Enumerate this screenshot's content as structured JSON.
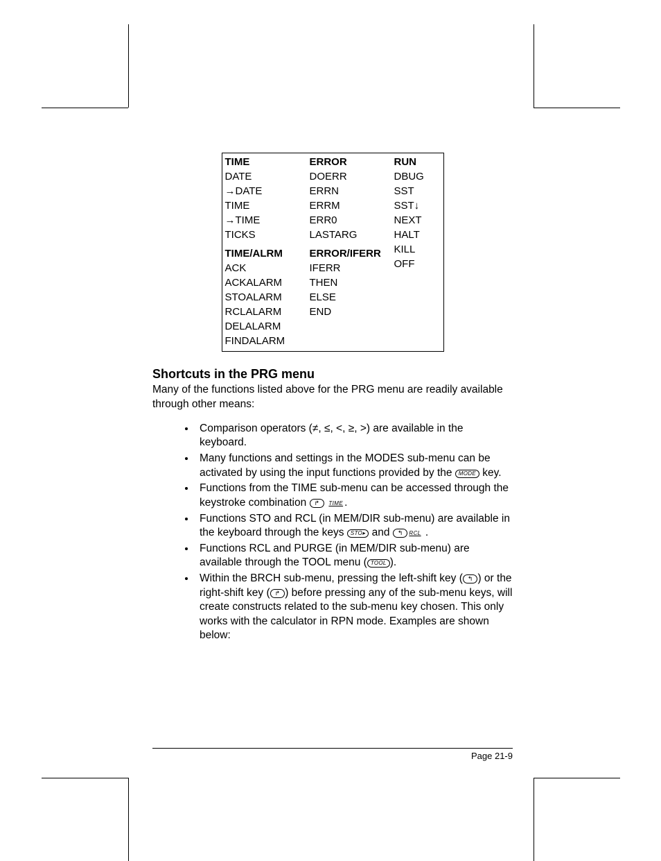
{
  "table": {
    "col1": {
      "header1": "TIME",
      "items1": [
        "DATE",
        "→DATE",
        "TIME",
        "→TIME",
        "TICKS"
      ],
      "header2": "TIME/ALRM",
      "items2": [
        "ACK",
        "ACKALARM",
        "STOALARM",
        "RCLALARM",
        "DELALARM",
        "FINDALARM"
      ]
    },
    "col2": {
      "header1": "ERROR",
      "items1": [
        "DOERR",
        "ERRN",
        "ERRM",
        "ERR0",
        "LASTARG"
      ],
      "header2": "ERROR/IFERR",
      "items2": [
        "IFERR",
        "THEN",
        "ELSE",
        "END"
      ]
    },
    "col3": {
      "header1": "RUN",
      "items1": [
        "DBUG",
        "SST",
        "SST↓",
        "NEXT",
        "HALT",
        "KILL",
        "OFF"
      ]
    }
  },
  "section_heading": "Shortcuts in the PRG menu",
  "intro_para": "Many of the functions listed above for the PRG menu are readily available through other means:",
  "bullets": {
    "b1": "Comparison operators (≠, ≤, <, ≥, >) are available in the keyboard.",
    "b2a": "Many functions and settings in the MODES sub-menu can be activated by using the input functions provided by the ",
    "b2_key": "MODE",
    "b2b": " key.",
    "b3a": "Functions from the TIME sub-menu can be accessed through the keystroke combination ",
    "b3_soft": "TIME",
    "b3b": ".",
    "b4a": "Functions STO and RCL (in MEM/DIR sub-menu) are available in the keyboard through the keys ",
    "b4_key1": "STO▸",
    "b4_mid": " and ",
    "b4_soft": "RCL",
    "b4b": " .",
    "b5a": "Functions RCL and PURGE (in MEM/DIR sub-menu) are available through the TOOL menu (",
    "b5_key": "TOOL",
    "b5b": ").",
    "b6a": "Within the BRCH sub-menu, pressing the left-shift key (",
    "b6b": ") or the right-shift key (",
    "b6c": ") before pressing any of the sub-menu keys, will create constructs related to the sub-menu key chosen.  This only works with the calculator in RPN mode.  Examples are shown below:"
  },
  "footer": "Page 21-9"
}
